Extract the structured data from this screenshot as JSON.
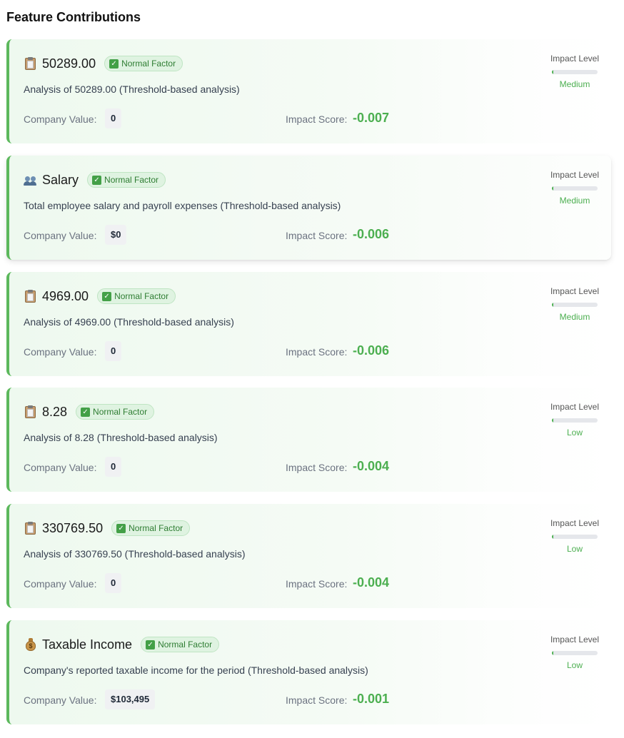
{
  "heading": "Feature Contributions",
  "labels": {
    "impact_level": "Impact Level",
    "company_value": "Company Value:",
    "impact_score": "Impact Score:",
    "badge_check": "✓"
  },
  "features": [
    {
      "icon": "clipboard-icon",
      "name": "50289.00",
      "badge": "Normal Factor",
      "description": "Analysis of 50289.00 (Threshold-based analysis)",
      "company_value": "0",
      "impact_score": "-0.007",
      "impact_level": "Medium",
      "impact_fraction": 0.03
    },
    {
      "icon": "people-icon",
      "name": "Salary",
      "badge": "Normal Factor",
      "description": "Total employee salary and payroll expenses (Threshold-based analysis)",
      "company_value": "$0",
      "impact_score": "-0.006",
      "impact_level": "Medium",
      "impact_fraction": 0.03
    },
    {
      "icon": "clipboard-icon",
      "name": "4969.00",
      "badge": "Normal Factor",
      "description": "Analysis of 4969.00 (Threshold-based analysis)",
      "company_value": "0",
      "impact_score": "-0.006",
      "impact_level": "Medium",
      "impact_fraction": 0.03
    },
    {
      "icon": "clipboard-icon",
      "name": "8.28",
      "badge": "Normal Factor",
      "description": "Analysis of 8.28 (Threshold-based analysis)",
      "company_value": "0",
      "impact_score": "-0.004",
      "impact_level": "Low",
      "impact_fraction": 0.02
    },
    {
      "icon": "clipboard-icon",
      "name": "330769.50",
      "badge": "Normal Factor",
      "description": "Analysis of 330769.50 (Threshold-based analysis)",
      "company_value": "0",
      "impact_score": "-0.004",
      "impact_level": "Low",
      "impact_fraction": 0.02
    },
    {
      "icon": "money-bag-icon",
      "name": "Taxable Income",
      "badge": "Normal Factor",
      "description": "Company's reported taxable income for the period (Threshold-based analysis)",
      "company_value": "$103,495",
      "impact_score": "-0.001",
      "impact_level": "Low",
      "impact_fraction": 0.01
    }
  ],
  "colors": {
    "accent": "#5cb85c",
    "score": "#4caf50",
    "badge_bg": "#dff3e1",
    "badge_text": "#2e7d32"
  }
}
